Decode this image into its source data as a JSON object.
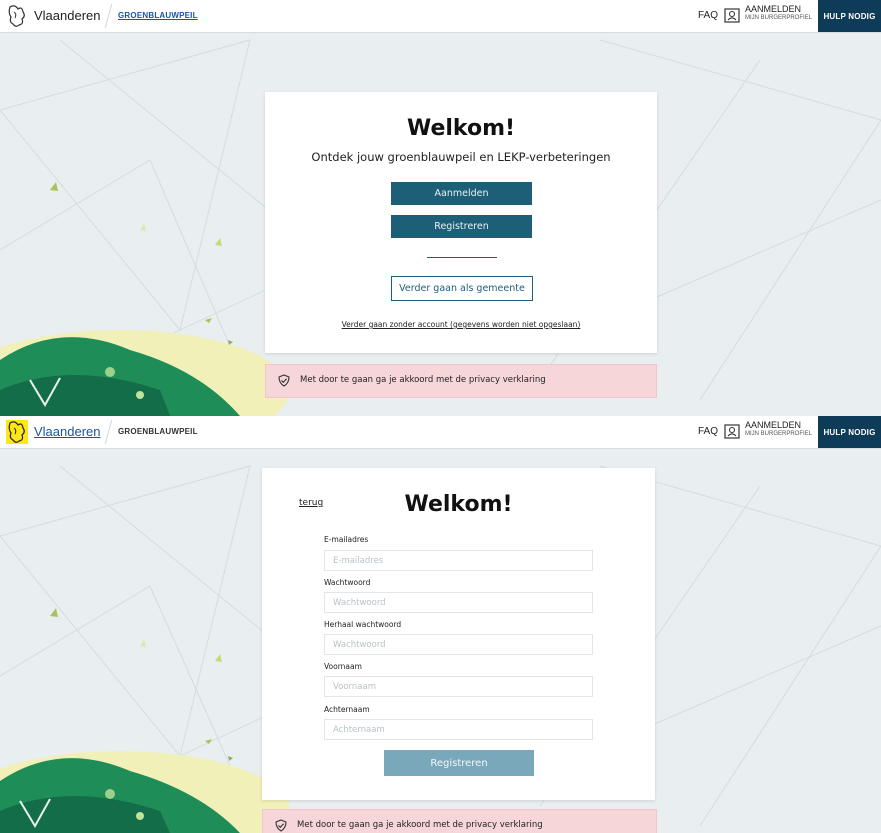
{
  "header": {
    "brand": "Vlaanderen",
    "site": "GROENBLAUWPEIL",
    "faq": "FAQ",
    "account_line1": "AANMELDEN",
    "account_line2": "MIJN BURGERPROFIEL",
    "help": "HULP NODIG"
  },
  "welcome_view": {
    "title": "Welkom!",
    "subtitle": "Ontdek jouw groenblauwpeil en LEKP-verbeteringen",
    "login_label": "Aanmelden",
    "register_label": "Registreren",
    "municipality_label": "Verder gaan als gemeente",
    "anonymous_link": "Verder gaan zonder account (gegevens worden niet opgeslaan)"
  },
  "register_view": {
    "back_link": "terug",
    "title": "Welkom!",
    "fields": [
      {
        "label": "E-mailadres",
        "placeholder": "E-mailadres",
        "value": ""
      },
      {
        "label": "Wachtwoord",
        "placeholder": "Wachtwoord",
        "value": ""
      },
      {
        "label": "Herhaal wachtwoord",
        "placeholder": "Wachtwoord",
        "value": ""
      },
      {
        "label": "Voornaam",
        "placeholder": "Voornaam",
        "value": ""
      },
      {
        "label": "Achternaam",
        "placeholder": "Achternaam",
        "value": ""
      }
    ],
    "submit_label": "Registreren"
  },
  "privacy_notice": "Met door te gaan ga je akkoord met de privacy verklaring",
  "icons": [
    "vlaanderen-lion-logo-icon",
    "account-icon",
    "shield-check-icon"
  ],
  "colors": {
    "primary": "#1e5f78",
    "primary_disabled": "#7aa8bb",
    "help_bg": "#0d3b58",
    "privacy_bg": "#f6d6d9",
    "page_bg": "#e9eef0",
    "link": "#1a55a3"
  }
}
